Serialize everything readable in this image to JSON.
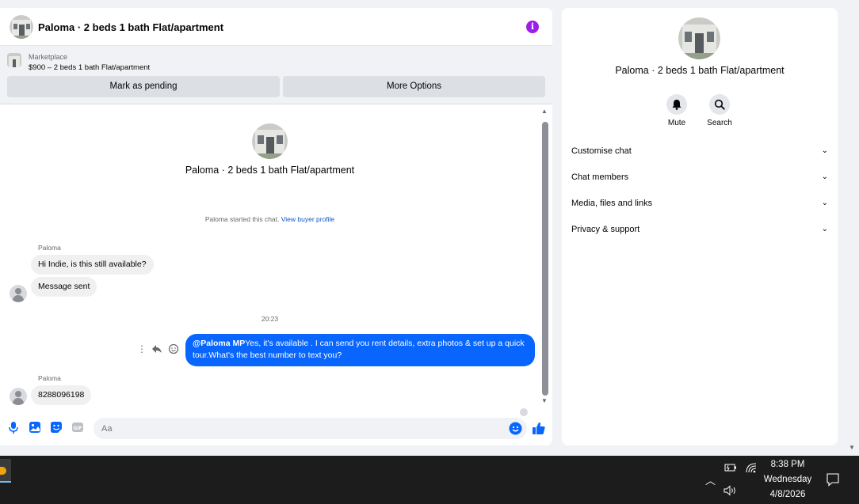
{
  "header": {
    "title": "Paloma · 2 beds 1 bath Flat/apartment",
    "info_glyph": "i"
  },
  "marketplace": {
    "kicker": "Marketplace",
    "item": "$900 – 2 beds 1 bath Flat/apartment",
    "pending_label": "Mark as pending",
    "options_label": "More Options"
  },
  "thread": {
    "profile_name": "Paloma · 2 beds 1 bath Flat/apartment",
    "started_text": "Paloma started this chat.",
    "view_profile": "View buyer profile",
    "messages": [
      {
        "sender": "Paloma",
        "text": "Hi Indie, is this still available?"
      },
      {
        "text": "Message sent"
      },
      {
        "timestamp": "20:23"
      },
      {
        "mention": "@Paloma MP",
        "text": "Yes, it's available .  I can send you rent details, extra photos & set up a quick tour.What's the best number to text you?"
      },
      {
        "sender": "Paloma",
        "text": "8288096198"
      }
    ]
  },
  "composer": {
    "placeholder": "Aa"
  },
  "info_panel": {
    "name": "Paloma · 2 beds 1 bath Flat/apartment",
    "mute_label": "Mute",
    "search_label": "Search",
    "sections": [
      "Customise chat",
      "Chat members",
      "Media, files and links",
      "Privacy & support"
    ]
  },
  "taskbar": {
    "time": "8:38 PM",
    "day": "Wednesday",
    "date": "4/8/2026"
  },
  "colors": {
    "accent": "#0866ff",
    "info_purple": "#9b1fe8",
    "bubble_in": "#f0f0f0"
  }
}
